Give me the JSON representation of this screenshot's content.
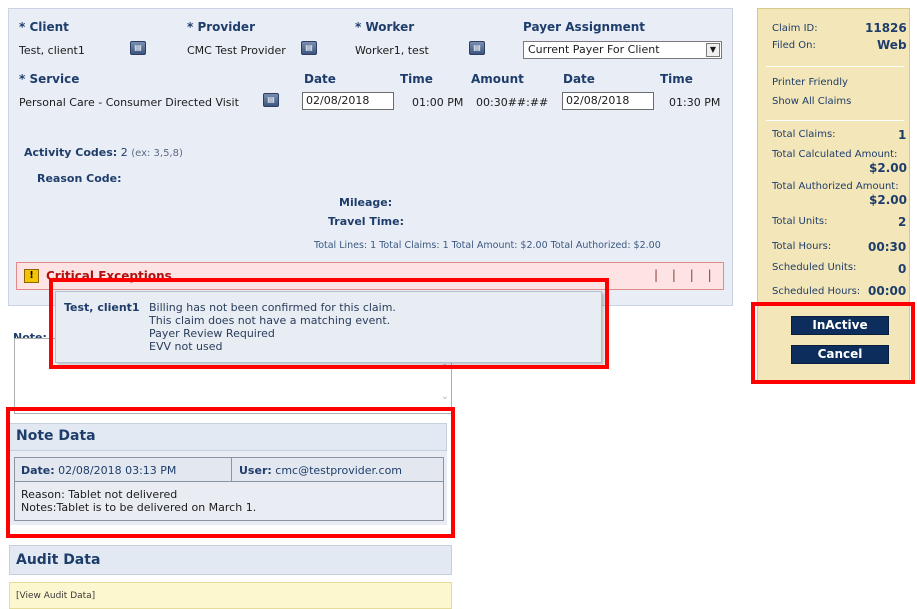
{
  "claim": {
    "client_header": "* Client",
    "provider_header": "* Provider",
    "worker_header": "* Worker",
    "payer_header": "Payer Assignment",
    "client_value": "Test, client1",
    "provider_value": "CMC Test Provider",
    "worker_value": "Worker1, test",
    "payer_value": "Current Payer For Client",
    "service_header": "* Service",
    "date_header": "Date",
    "time_header": "Time",
    "amount_header": "Amount",
    "date2_header": "Date",
    "time2_header": "Time",
    "service_value": "Personal Care - Consumer Directed Visit",
    "start_date": "02/08/2018",
    "start_time": "01:00 PM",
    "amount": "00:30##:##",
    "end_date": "02/08/2018",
    "end_time": "01:30 PM",
    "activity_label": "Activity Codes:",
    "activity_value": "2",
    "activity_hint": "(ex: 3,5,8)",
    "reason_label": "Reason Code:",
    "mileage_label": "Mileage:",
    "travel_label": "Travel Time:",
    "totals_line": "Total Lines: 1 Total Claims: 1 Total Amount: $2.00 Total Authorized: $2.00"
  },
  "exceptions": {
    "title": "Critical Exceptions",
    "bars": "| | | |"
  },
  "tooltip": {
    "client": "Test, client1",
    "messages": [
      "Billing has not been confirmed for this claim.",
      "This claim does not have a matching event.",
      "Payer Review Required",
      "EVV not used"
    ]
  },
  "notes": {
    "label": "Note:"
  },
  "note_data": {
    "title": "Note Data",
    "date_label": "Date:",
    "date_value": "02/08/2018 03:13 PM",
    "user_label": "User:",
    "user_value": "cmc@testprovider.com",
    "reason": "Reason: Tablet not delivered",
    "notes": "Notes:Tablet is to be delivered on March 1."
  },
  "audit": {
    "title": "Audit Data",
    "link": "[View Audit Data]"
  },
  "summary": {
    "claim_id_label": "Claim ID:",
    "claim_id": "11826",
    "filed_on_label": "Filed On:",
    "filed_on": "Web",
    "printer_friendly": "Printer Friendly",
    "show_all": "Show All Claims",
    "total_claims_label": "Total Claims:",
    "total_claims": "1",
    "calc_amount_label": "Total Calculated Amount:",
    "calc_amount": "$2.00",
    "auth_amount_label": "Total Authorized Amount:",
    "auth_amount": "$2.00",
    "total_units_label": "Total Units:",
    "total_units": "2",
    "total_hours_label": "Total Hours:",
    "total_hours": "00:30",
    "sched_units_label": "Scheduled Units:",
    "sched_units": "0",
    "sched_hours_label": "Scheduled Hours:",
    "sched_hours": "00:00",
    "inactive_button": "InActive",
    "cancel_button": "Cancel"
  },
  "colors": {
    "highlight_red": "#ff0000",
    "summary_bg": "#f3e6b8",
    "panel_bg": "#e9eef6",
    "button_navy": "#0d2d5c"
  }
}
